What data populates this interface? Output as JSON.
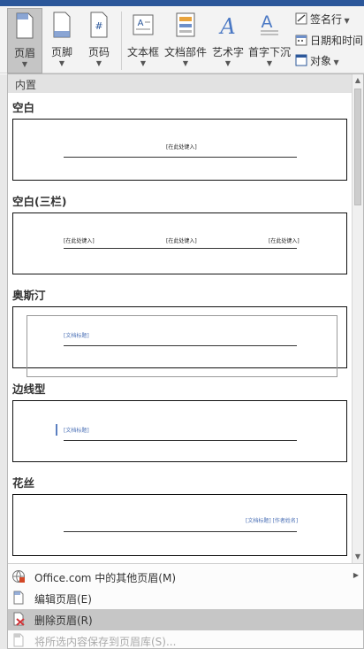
{
  "ribbon": {
    "buttons": [
      {
        "label": "页眉",
        "icon": "header-icon"
      },
      {
        "label": "页脚",
        "icon": "footer-icon"
      },
      {
        "label": "页码",
        "icon": "page-number-icon"
      },
      {
        "label": "文本框",
        "icon": "textbox-icon"
      },
      {
        "label": "文档部件",
        "icon": "quick-parts-icon"
      },
      {
        "label": "艺术字",
        "icon": "wordart-icon"
      },
      {
        "label": "首字下沉",
        "icon": "drop-cap-icon"
      }
    ],
    "small": [
      {
        "label": "签名行",
        "icon": "signature-line-icon"
      },
      {
        "label": "日期和时间",
        "icon": "date-time-icon"
      },
      {
        "label": "对象",
        "icon": "object-icon"
      }
    ]
  },
  "gallery": {
    "section_title": "内置",
    "items": [
      {
        "name": "空白",
        "placeholder": "[在此处键入]"
      },
      {
        "name": "空白(三栏)",
        "placeholders": [
          "[在此处键入]",
          "[在此处键入]",
          "[在此处键入]"
        ]
      },
      {
        "name": "奥斯汀",
        "placeholder": "[文档标题]"
      },
      {
        "name": "边线型",
        "placeholder": "[文档标题]"
      },
      {
        "name": "花丝",
        "placeholder": "[文档标题] [作者姓名]"
      }
    ]
  },
  "menu": {
    "items": [
      {
        "label": "Office.com 中的其他页眉(M)",
        "icon": "office-com-icon",
        "has_submenu": true
      },
      {
        "label": "编辑页眉(E)",
        "icon": "edit-header-icon"
      },
      {
        "label": "删除页眉(R)",
        "icon": "remove-header-icon"
      },
      {
        "label": "将所选内容保存到页眉库(S)...",
        "icon": "save-selection-icon",
        "disabled": true
      }
    ]
  },
  "colors": {
    "accent": "#2b579a",
    "highlight": "#c6c6c6",
    "placeholder_blue": "#4a6fb5"
  }
}
